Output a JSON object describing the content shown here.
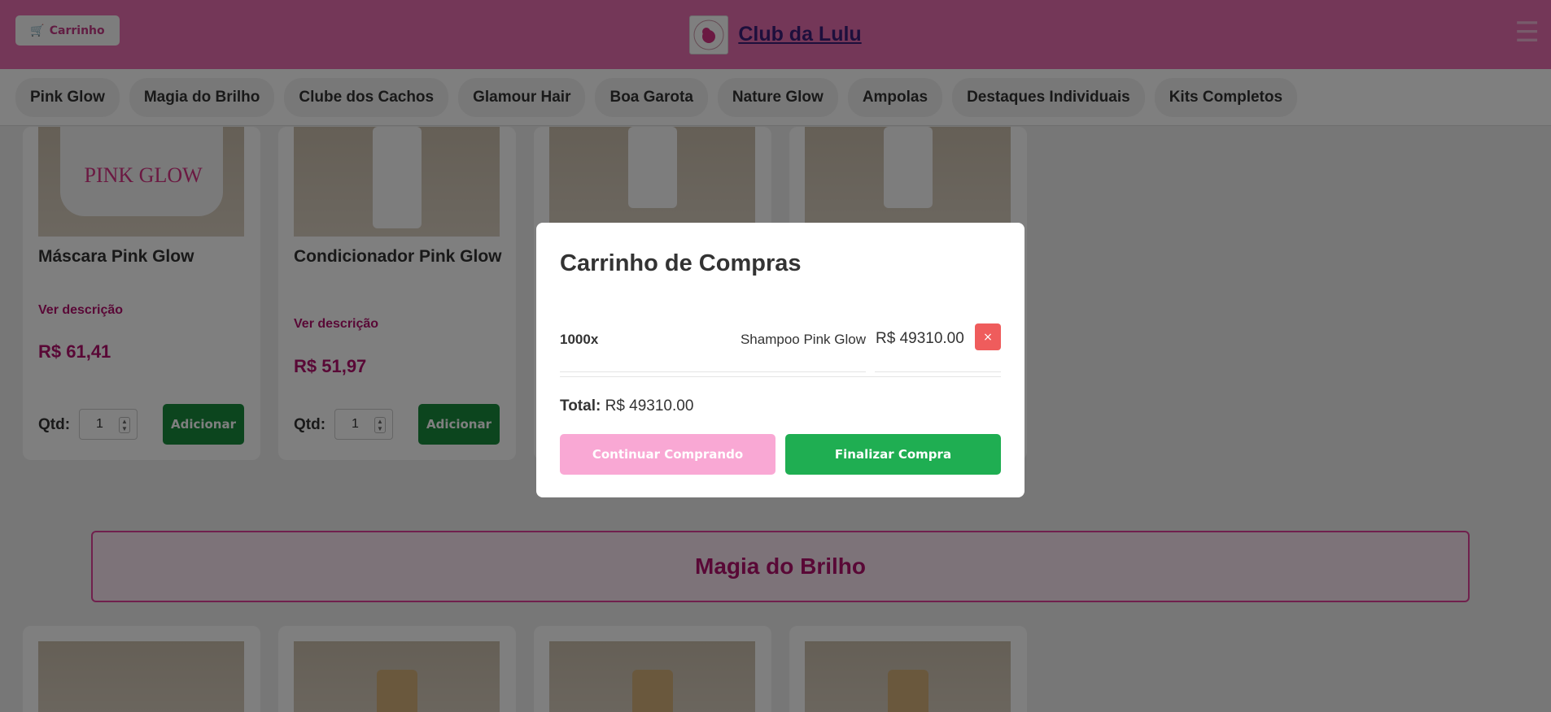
{
  "header": {
    "cart_button": "Carrinho",
    "brand_title": "Club da Lulu",
    "menu_icon": "hamburger-icon"
  },
  "nav": {
    "items": [
      {
        "label": "Pink Glow"
      },
      {
        "label": "Magia do Brilho"
      },
      {
        "label": "Clube dos Cachos"
      },
      {
        "label": "Glamour Hair"
      },
      {
        "label": "Boa Garota"
      },
      {
        "label": "Nature Glow"
      },
      {
        "label": "Ampolas"
      },
      {
        "label": "Destaques Individuais"
      },
      {
        "label": "Kits Completos"
      }
    ]
  },
  "products": [
    {
      "name": "Máscara Pink Glow",
      "desc_link": "Ver descrição",
      "price": "R$ 61,41",
      "qty_label": "Qtd:",
      "qty": "1",
      "add_label": "Adicionar"
    },
    {
      "name": "Condicionador Pink Glow",
      "desc_link": "Ver descrição",
      "price": "R$ 51,97",
      "qty_label": "Qtd:",
      "qty": "1",
      "add_label": "Adicionar"
    }
  ],
  "section_banner": "Magia do Brilho",
  "modal": {
    "title": "Carrinho de Compras",
    "items": [
      {
        "qty": "1000x",
        "name": "Shampoo Pink Glow",
        "price": "R$ 49310.00",
        "remove_label": "×"
      }
    ],
    "total_label": "Total:",
    "total_value": "R$ 49310.00",
    "continue_label": "Continuar Comprando",
    "finish_label": "Finalizar Compra"
  },
  "colors": {
    "header_bg": "#e86fb0",
    "accent": "#b3106c",
    "add_button": "#198a3c",
    "finish_button": "#1fae52",
    "continue_button": "#f9a8d4",
    "remove_button": "#ef5c5c"
  }
}
